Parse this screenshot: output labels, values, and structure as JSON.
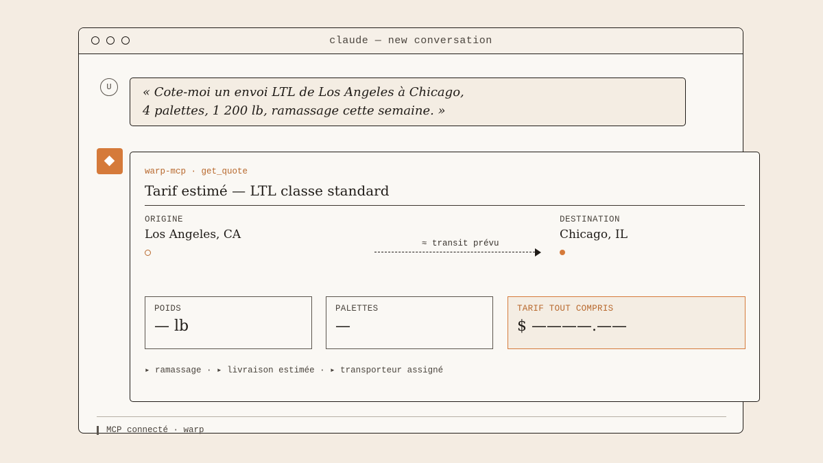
{
  "window": {
    "title": "claude — new conversation"
  },
  "user": {
    "avatar_label": "U",
    "message_line1": "« Cote-moi un envoi LTL de Los Angeles à Chicago,",
    "message_line2": "4 palettes, 1 200 lb, ramassage cette semaine. »"
  },
  "quote": {
    "tool_tag": "warp-mcp · get_quote",
    "title": "Tarif estimé — LTL classe standard",
    "origin_label": "ORIGINE",
    "origin_city": "Los Angeles, CA",
    "destination_label": "DESTINATION",
    "destination_city": "Chicago, IL",
    "transit_label": "≈ transit prévu",
    "weight_label": "POIDS",
    "weight_value": "— lb",
    "pallets_label": "PALETTES",
    "pallets_value": "—",
    "total_label": "TARIF TOUT COMPRIS",
    "total_value": "$ ————.——",
    "footer": "▸ ramassage · ▸ livraison estimée · ▸ transporteur assigné"
  },
  "status": {
    "text": "MCP connecté · warp"
  },
  "colors": {
    "accent": "#d57a3a",
    "accent_text": "#b8692e",
    "background": "#f4ece2"
  },
  "icons": {
    "assistant": "diamond-icon"
  }
}
